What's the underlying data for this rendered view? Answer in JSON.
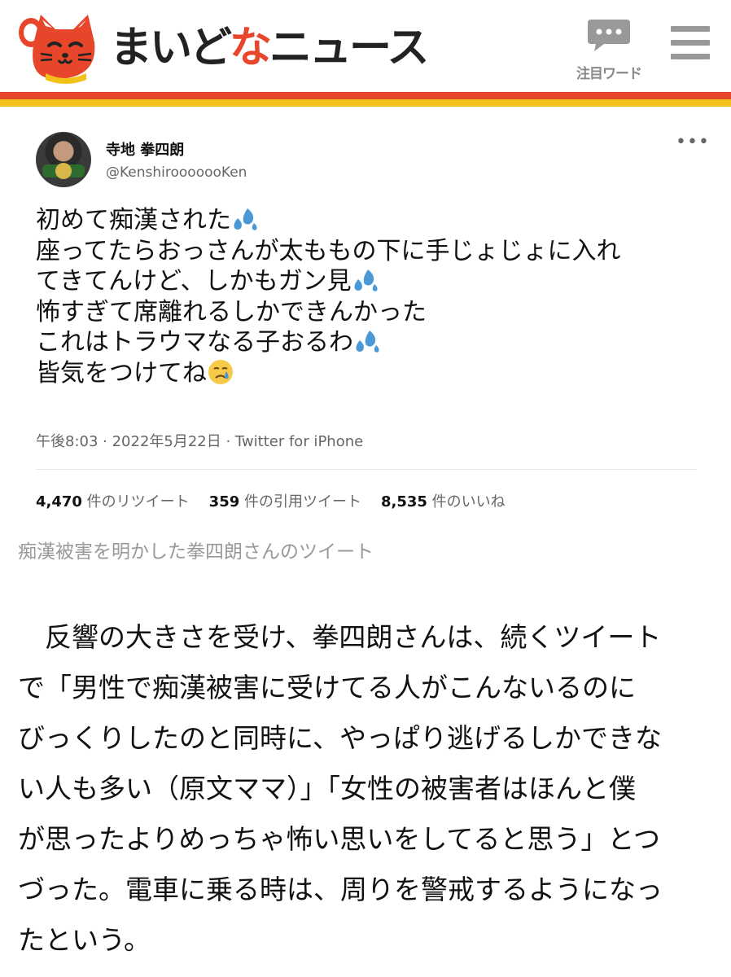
{
  "header": {
    "logo_text_part1": "まいど",
    "logo_text_accent": "な",
    "logo_text_part2": "ニュース",
    "trend_words_label": "注目ワード",
    "colors": {
      "brand_red": "#e8462a",
      "brand_yellow": "#f2c21b"
    }
  },
  "tweet": {
    "name": "寺地 拳四朗",
    "handle": "@KenshirooooooKen",
    "lines": [
      "初めて痴漢された",
      "座ってたらおっさんが太ももの下に手じょじょに入れ",
      "てきてんけど、しかもガン見",
      "怖すぎて席離れるしかできんかった",
      "これはトラウマなる子おるわ",
      "皆気をつけてね"
    ],
    "meta": "午後8:03 · 2022年5月22日 · Twitter for iPhone",
    "retweets_count": "4,470",
    "retweets_label": "件のリツイート",
    "quotes_count": "359",
    "quotes_label": "件の引用ツイート",
    "likes_count": "8,535",
    "likes_label": "件のいいね"
  },
  "caption": "痴漢被害を明かした拳四朗さんのツイート",
  "article": {
    "lines": [
      "　反響の大きさを受け、拳四朗さんは、続くツイート",
      "で「男性で痴漢被害に受けてる人がこんないるのに",
      "びっくりしたのと同時に、やっぱり逃げるしかできな",
      "い人も多い（原文ママ）」「女性の被害者はほんと僕",
      "が思ったよりめっちゃ怖い思いをしてると思う」とつ",
      "づった。電車に乗る時は、周りを警戒するようになっ",
      "たという。"
    ]
  }
}
